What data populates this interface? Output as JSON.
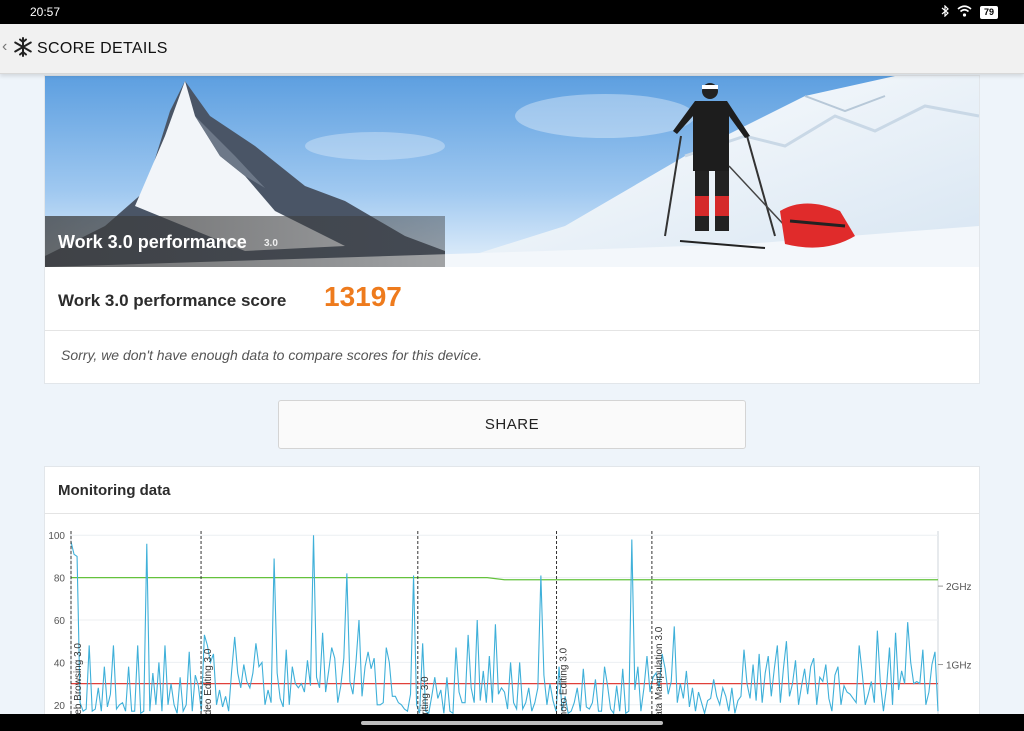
{
  "status_bar": {
    "time": "20:57",
    "battery": "79"
  },
  "toolbar": {
    "title": "SCORE DETAILS"
  },
  "hero": {
    "title": "Work 3.0 performance",
    "version": "3.0"
  },
  "score": {
    "label": "Work 3.0 performance score",
    "value": "13197"
  },
  "compare_message": "Sorry, we don't have enough data to compare scores for this device.",
  "share_label": "SHARE",
  "monitoring": {
    "title": "Monitoring data"
  },
  "colors": {
    "accent": "#ee7b1d",
    "cpu_load": "#3fb0d9",
    "frequency": "#64c23c",
    "temperature": "#e0403a"
  },
  "chart_data": {
    "type": "line",
    "y_ticks": [
      "100",
      "80",
      "60",
      "40",
      "20"
    ],
    "ylim": [
      10,
      102
    ],
    "right_ticks": [
      "2GHz",
      "1GHz"
    ],
    "segments": [
      "Web Browsing 3.0",
      "Video Editing 3.0",
      "Writing 3.0",
      "Photo Editing 3.0",
      "Data Manipulation 3.0"
    ],
    "segment_positions": [
      0,
      0.15,
      0.4,
      0.56,
      0.67
    ],
    "green_line": {
      "values": [
        80,
        80,
        80,
        79,
        79
      ],
      "x": [
        0,
        0.4,
        0.48,
        0.5,
        1
      ]
    },
    "red_line": {
      "value": 30
    },
    "series": [
      {
        "values": [
          97,
          91,
          90,
          21,
          17,
          18,
          48,
          17,
          18,
          28,
          17,
          38,
          19,
          25,
          48,
          18,
          20,
          21,
          17,
          38,
          17,
          17,
          48,
          16,
          17,
          96,
          17,
          35,
          20,
          40,
          17,
          48,
          20,
          30,
          20,
          16,
          33,
          17,
          20,
          45,
          17,
          34,
          29,
          17,
          53,
          48,
          40,
          44,
          20,
          27,
          19,
          24,
          17,
          36,
          52,
          35,
          28,
          39,
          31,
          28,
          35,
          49,
          38,
          40,
          20,
          27,
          21,
          89,
          35,
          23,
          19,
          46,
          20,
          38,
          30,
          28,
          30,
          26,
          41,
          29,
          100,
          33,
          28,
          54,
          26,
          36,
          47,
          42,
          21,
          29,
          42,
          82,
          31,
          25,
          40,
          60,
          24,
          38,
          45,
          37,
          42,
          20,
          20,
          21,
          47,
          40,
          24,
          24,
          21,
          20,
          18,
          17,
          25,
          81,
          20,
          16,
          49,
          17,
          16,
          24,
          33,
          23,
          27,
          16,
          33,
          17,
          16,
          47,
          26,
          21,
          21,
          53,
          28,
          21,
          60,
          22,
          36,
          21,
          43,
          21,
          58,
          25,
          28,
          26,
          18,
          40,
          21,
          18,
          40,
          18,
          21,
          28,
          17,
          21,
          28,
          81,
          34,
          20,
          30,
          22,
          17,
          38,
          17,
          24,
          16,
          17,
          21,
          28,
          17,
          37,
          19,
          18,
          21,
          32,
          17,
          17,
          38,
          29,
          18,
          16,
          29,
          17,
          37,
          16,
          17,
          98,
          27,
          38,
          17,
          28,
          43,
          26,
          33,
          35,
          28,
          44,
          37,
          25,
          31,
          57,
          21,
          30,
          23,
          36,
          19,
          28,
          17,
          26,
          21,
          16,
          22,
          23,
          32,
          24,
          20,
          28,
          24,
          17,
          28,
          16,
          22,
          24,
          46,
          30,
          23,
          39,
          22,
          44,
          21,
          35,
          43,
          24,
          37,
          48,
          21,
          37,
          50,
          24,
          30,
          41,
          20,
          29,
          37,
          25,
          38,
          42,
          20,
          33,
          31,
          39,
          23,
          17,
          34,
          38,
          20,
          29,
          26,
          25,
          23,
          21,
          48,
          35,
          20,
          25,
          31,
          21,
          55,
          30,
          17,
          28,
          47,
          20,
          54,
          27,
          36,
          30,
          59,
          40,
          30,
          31,
          30,
          46,
          20,
          26,
          39,
          45,
          17
        ]
      }
    ]
  }
}
